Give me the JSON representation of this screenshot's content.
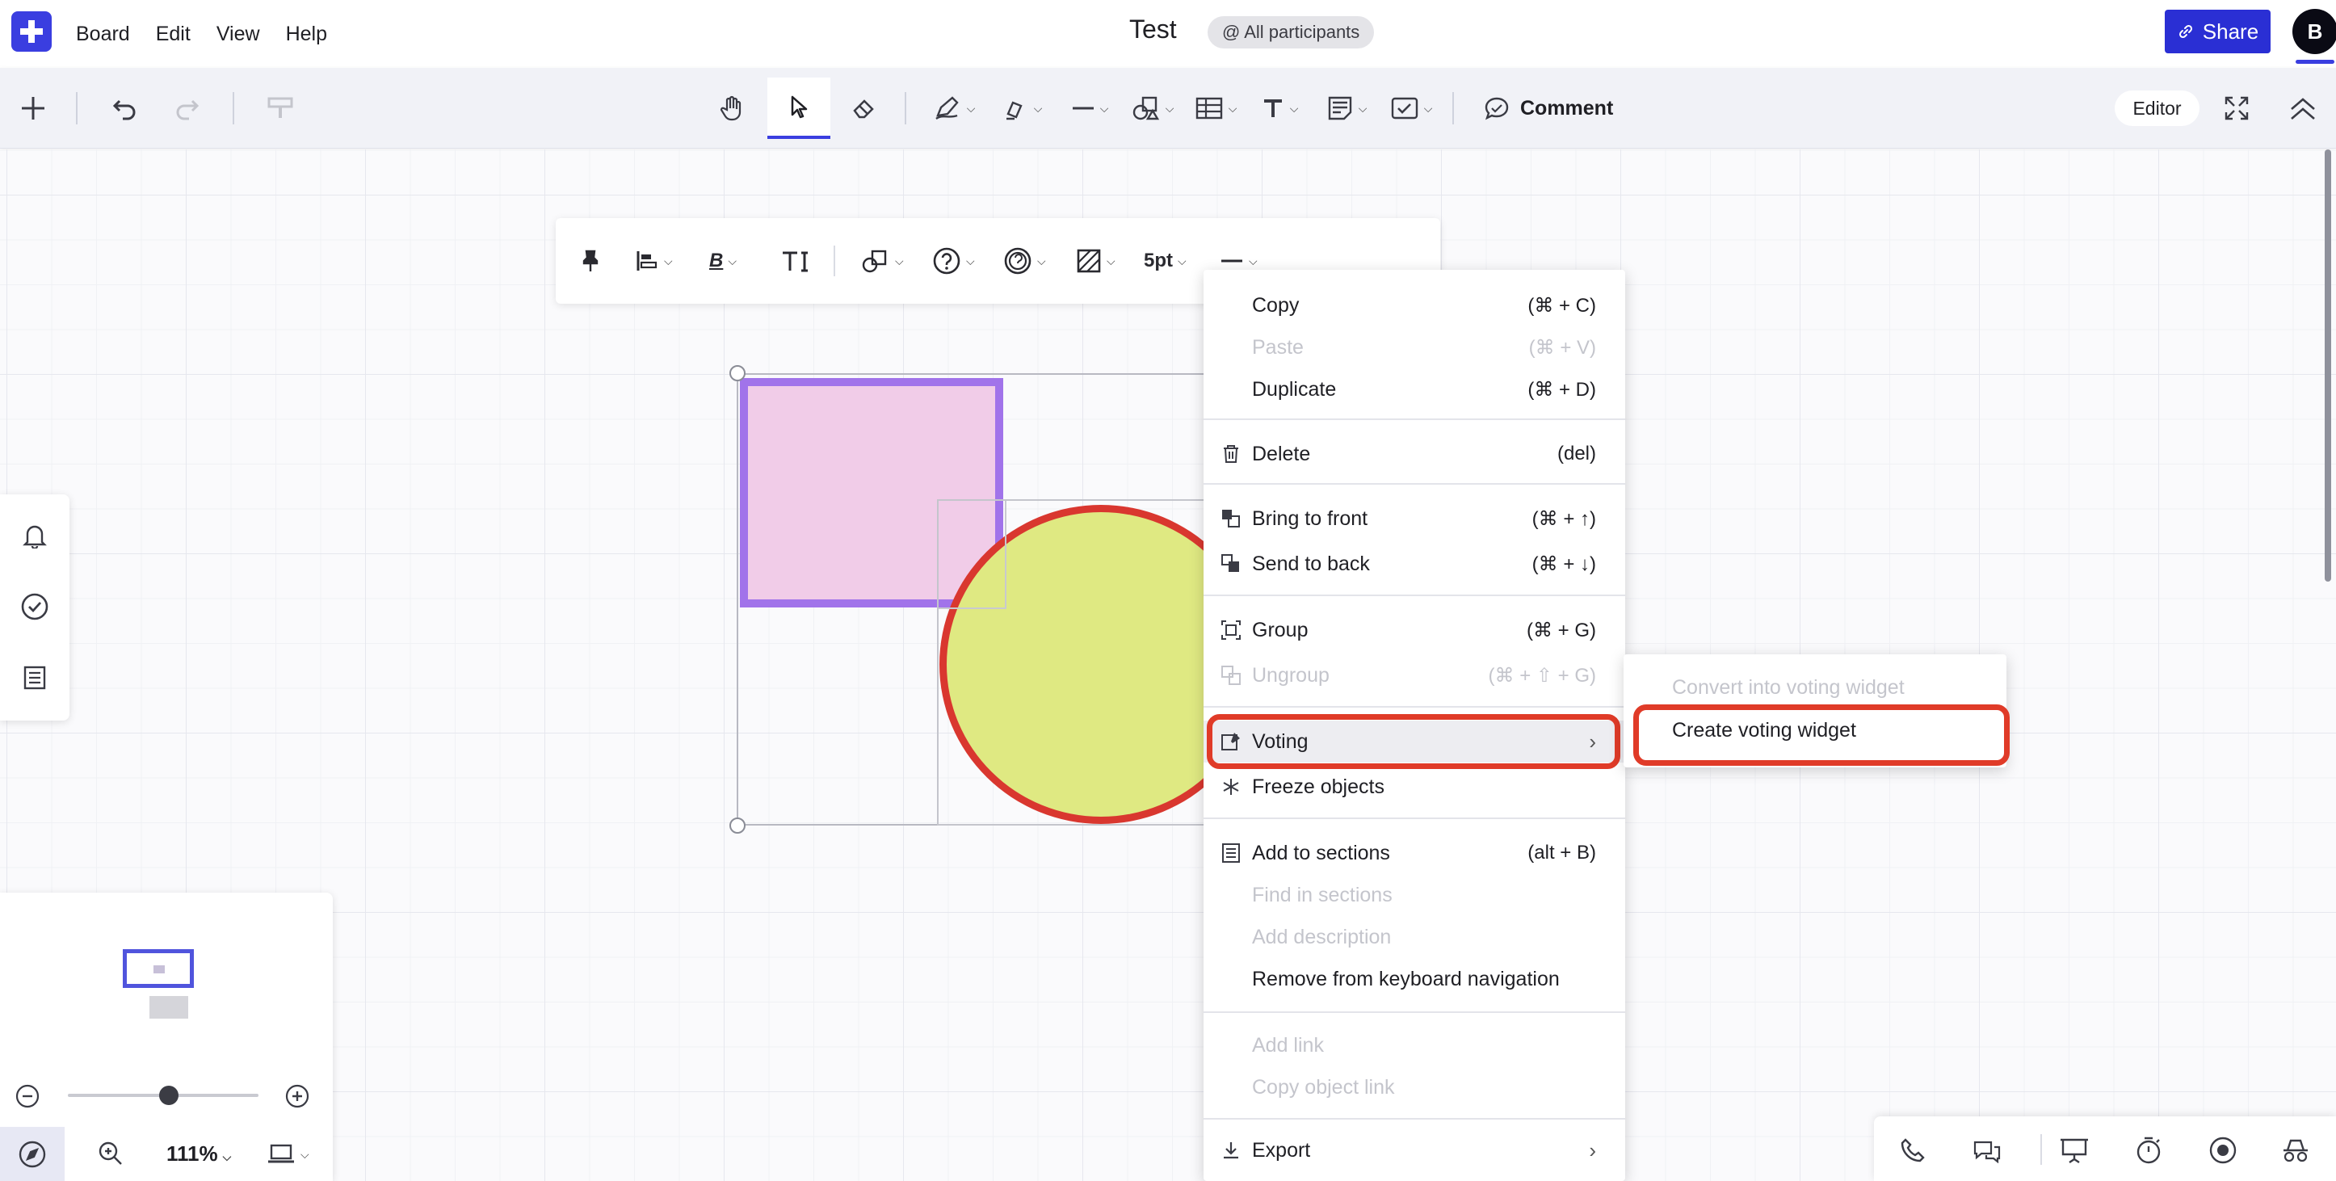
{
  "header": {
    "menu": [
      "Board",
      "Edit",
      "View",
      "Help"
    ],
    "title": "Test",
    "participants": "@ All participants",
    "share_label": "Share",
    "avatar_initial": "B"
  },
  "toolbar": {
    "comment_label": "Comment",
    "mode_label": "Editor",
    "icons": [
      "add-icon",
      "undo-icon",
      "redo-icon",
      "format-painter-icon",
      "hand-icon",
      "select-cursor-icon",
      "eraser-icon",
      "pen-icon",
      "highlighter-icon",
      "line-icon",
      "shapes-icon",
      "table-icon",
      "text-icon",
      "sticky-note-icon",
      "checkbox-icon",
      "comment-icon",
      "fullscreen-icon",
      "collapse-icon"
    ]
  },
  "object_toolbar": {
    "stroke_width": "5pt"
  },
  "context_menu": {
    "items": [
      {
        "label": "Copy",
        "shortcut": "(⌘ + C)",
        "disabled": false
      },
      {
        "label": "Paste",
        "shortcut": "(⌘ + V)",
        "disabled": true
      },
      {
        "label": "Duplicate",
        "shortcut": "(⌘ + D)",
        "disabled": false
      },
      {
        "label": "Delete",
        "shortcut": "(del)",
        "disabled": false
      },
      {
        "label": "Bring to front",
        "shortcut": "(⌘ + ↑)",
        "disabled": false
      },
      {
        "label": "Send to back",
        "shortcut": "(⌘ + ↓)",
        "disabled": false
      },
      {
        "label": "Group",
        "shortcut": "(⌘ + G)",
        "disabled": false
      },
      {
        "label": "Ungroup",
        "shortcut": "(⌘ + ⇧ + G)",
        "disabled": true
      },
      {
        "label": "Voting",
        "shortcut": "",
        "disabled": false
      },
      {
        "label": "Freeze objects",
        "shortcut": "",
        "disabled": false
      },
      {
        "label": "Add to sections",
        "shortcut": "(alt + B)",
        "disabled": false
      },
      {
        "label": "Find in sections",
        "shortcut": "",
        "disabled": true
      },
      {
        "label": "Add description",
        "shortcut": "",
        "disabled": true
      },
      {
        "label": "Remove from keyboard navigation",
        "shortcut": "",
        "disabled": false
      },
      {
        "label": "Add link",
        "shortcut": "",
        "disabled": true
      },
      {
        "label": "Copy object link",
        "shortcut": "",
        "disabled": true
      },
      {
        "label": "Export",
        "shortcut": "",
        "disabled": false
      }
    ]
  },
  "voting_submenu": {
    "items": [
      {
        "label": "Convert into voting widget",
        "disabled": true
      },
      {
        "label": "Create voting widget",
        "disabled": false
      }
    ]
  },
  "minimap": {
    "zoom_level": "111%",
    "zoom_fraction": 0.53
  },
  "colors": {
    "brand": "#3a3ee0",
    "share_button": "#2a2fd4",
    "highlight_ring": "#e03b28",
    "pink_fill": "#f1cce8",
    "purple_stroke": "#a173ea",
    "yellow_fill": "#dfe982",
    "red_stroke": "#d9372f"
  }
}
